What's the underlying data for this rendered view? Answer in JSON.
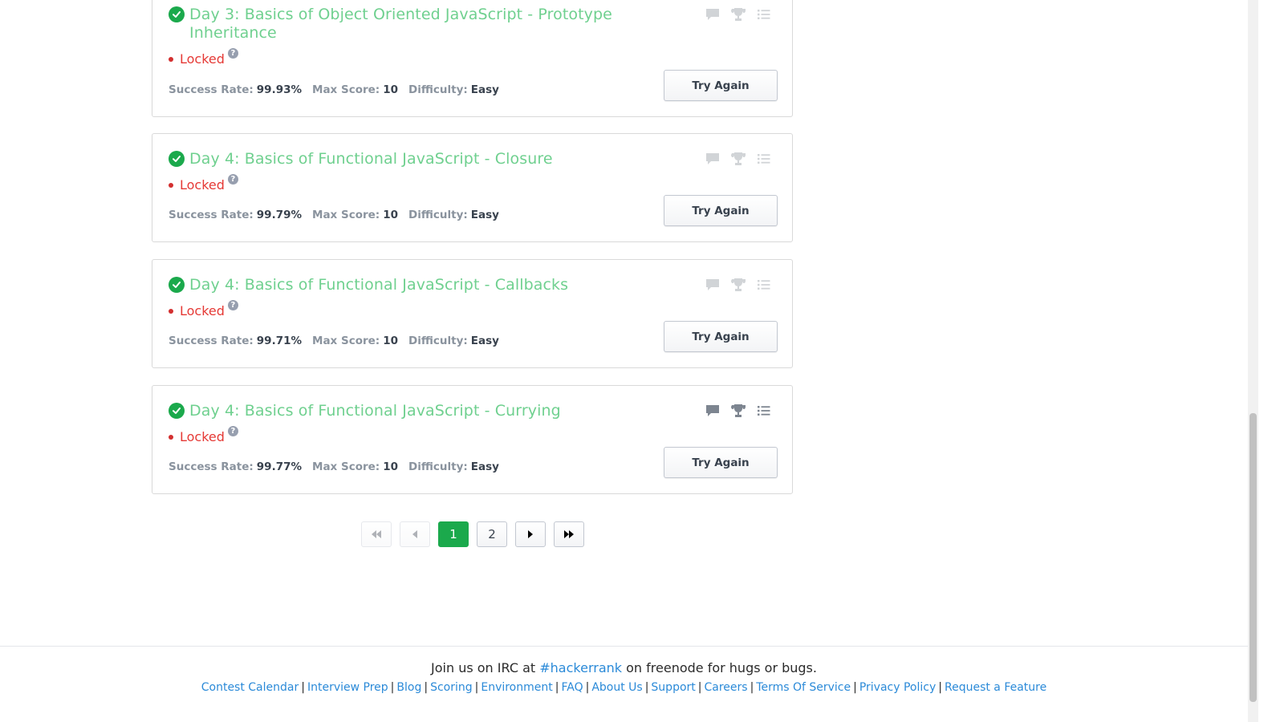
{
  "challenges": [
    {
      "title": "Day 3: Basics of Object Oriented JavaScript - Prototype Inheritance",
      "status": "Locked",
      "success_rate_label": "Success Rate:",
      "success_rate": "99.93%",
      "max_score_label": "Max Score:",
      "max_score": "10",
      "difficulty_label": "Difficulty:",
      "difficulty": "Easy",
      "button": "Try Again"
    },
    {
      "title": "Day 4: Basics of Functional JavaScript - Closure",
      "status": "Locked",
      "success_rate_label": "Success Rate:",
      "success_rate": "99.79%",
      "max_score_label": "Max Score:",
      "max_score": "10",
      "difficulty_label": "Difficulty:",
      "difficulty": "Easy",
      "button": "Try Again"
    },
    {
      "title": "Day 4: Basics of Functional JavaScript - Callbacks",
      "status": "Locked",
      "success_rate_label": "Success Rate:",
      "success_rate": "99.71%",
      "max_score_label": "Max Score:",
      "max_score": "10",
      "difficulty_label": "Difficulty:",
      "difficulty": "Easy",
      "button": "Try Again"
    },
    {
      "title": "Day 4: Basics of Functional JavaScript - Currying",
      "status": "Locked",
      "success_rate_label": "Success Rate:",
      "success_rate": "99.77%",
      "max_score_label": "Max Score:",
      "max_score": "10",
      "difficulty_label": "Difficulty:",
      "difficulty": "Easy",
      "button": "Try Again"
    }
  ],
  "help_glyph": "?",
  "pagination": {
    "pages": [
      "1",
      "2"
    ],
    "current_page": "1"
  },
  "footer": {
    "irc_prefix": "Join us on IRC at",
    "irc_channel": "#hackerrank",
    "irc_suffix": "on freenode for hugs or bugs.",
    "links": [
      "Contest Calendar",
      "Interview Prep",
      "Blog",
      "Scoring",
      "Environment",
      "FAQ",
      "About Us",
      "Support",
      "Careers",
      "Terms Of Service",
      "Privacy Policy",
      "Request a Feature"
    ]
  },
  "colors": {
    "accent_green": "#1ba94c",
    "title_green": "#6fd08f",
    "locked_red": "#e53935",
    "link_blue": "#2b8ad8"
  },
  "icons": [
    "check-circle-icon",
    "help-icon",
    "discussion-icon",
    "trophy-icon",
    "list-icon",
    "first-page-icon",
    "previous-page-icon",
    "next-page-icon",
    "last-page-icon"
  ]
}
